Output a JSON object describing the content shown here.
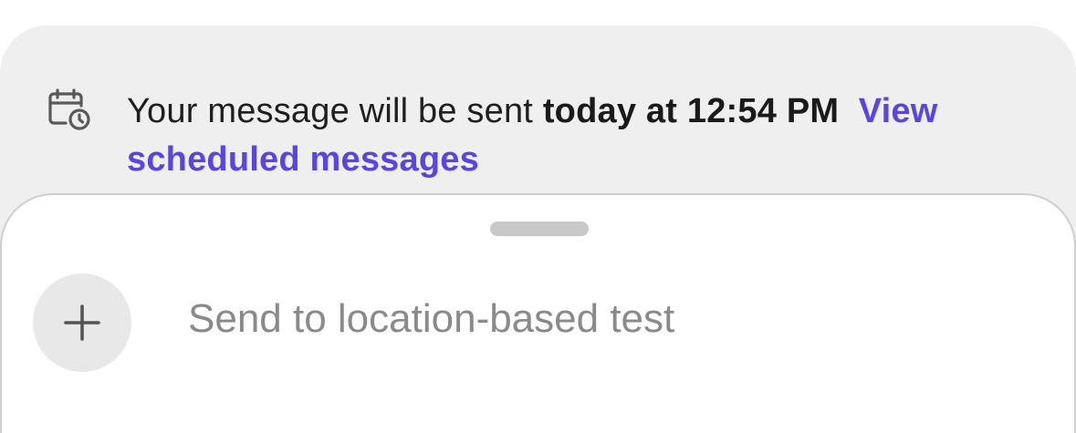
{
  "banner": {
    "icon": "calendar-clock-icon",
    "text_prefix": "Your message will be sent ",
    "text_time": "today at 12:54 PM",
    "link_label": "View scheduled messages"
  },
  "composer": {
    "add_icon": "plus-icon",
    "placeholder": "Send to location-based test",
    "value": ""
  },
  "colors": {
    "banner_bg": "#efefef",
    "link": "#5b45e0",
    "placeholder": "#8a8a8a",
    "add_button_bg": "#e8e8e8"
  }
}
